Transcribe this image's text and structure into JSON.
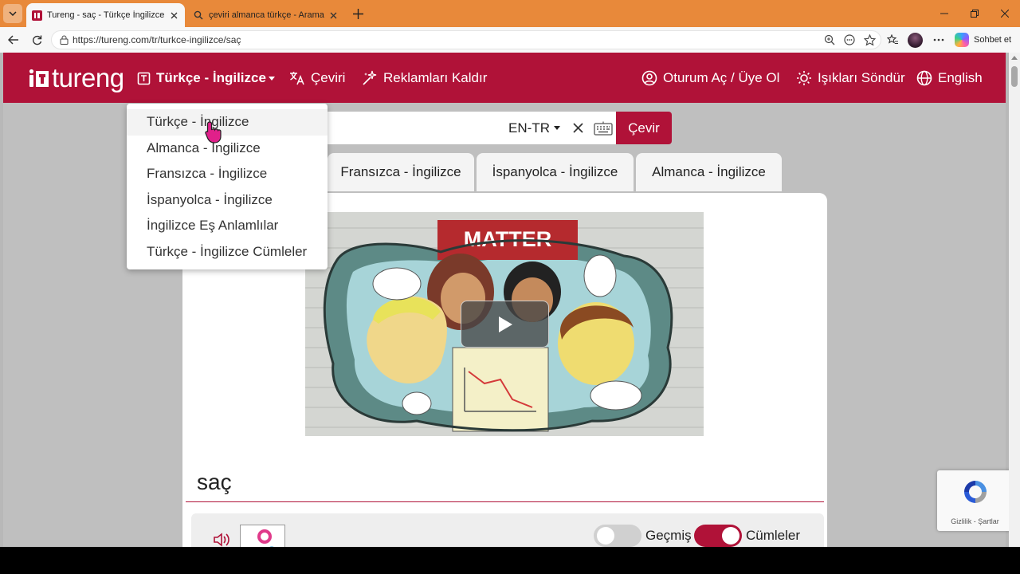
{
  "browser": {
    "tabs": [
      {
        "title": "Tureng - saç - Türkçe İngilizce Sözlük",
        "active": true,
        "favicon": "tureng-favicon"
      },
      {
        "title": "çeviri almanca türkçe - Arama",
        "active": false,
        "favicon": "search-icon"
      }
    ],
    "url": "https://tureng.com/tr/turkce-ingilizce/saç",
    "copilot_label": "Sohbet et",
    "colors": {
      "tabstrip": "#e8893a"
    }
  },
  "site": {
    "logo": "tureng",
    "nav": {
      "dictionary": "Türkçe - İngilizce",
      "translate": "Çeviri",
      "remove_ads": "Reklamları Kaldır",
      "login": "Oturum Aç / Üye Ol",
      "lights_off": "Işıkları Söndür",
      "language": "English"
    },
    "search": {
      "lang_pair": "EN-TR",
      "button": "Çevir"
    },
    "lang_tabs": [
      "Fransızca - İngilizce",
      "İspanyolca - İngilizce",
      "Almanca - İngilizce"
    ],
    "dropdown_items": [
      "Türkçe - İngilizce",
      "Almanca - İngilizce",
      "Fransızca - İngilizce",
      "İspanyolca - İngilizce",
      "İngilizce Eş Anlamlılar",
      "Türkçe - İngilizce Cümleler"
    ],
    "video": {
      "sign": "MATTER"
    },
    "word": "saç",
    "options": {
      "history_label": "Geçmiş",
      "history_on": false,
      "sentences_label": "Cümleler",
      "sentences_on": true
    },
    "recaptcha": "Gizlilik - Şartlar",
    "colors": {
      "brand": "#b01238"
    }
  }
}
